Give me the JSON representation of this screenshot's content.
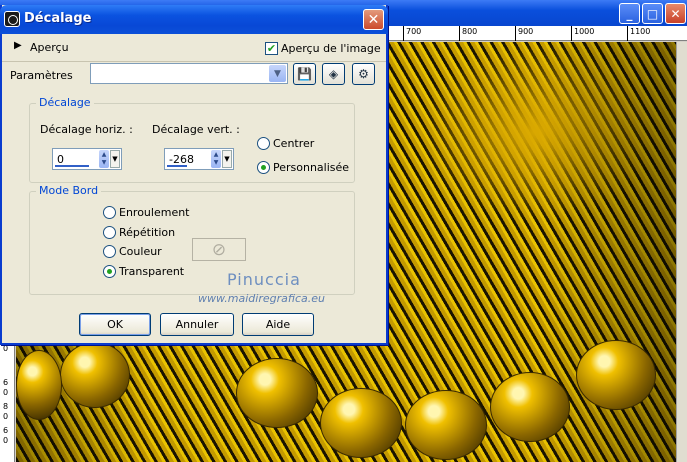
{
  "background_window": {
    "ruler_top_labels": [
      "700",
      "800",
      "900",
      "1000",
      "1100"
    ],
    "ruler_left_labels": [
      "0",
      "6",
      "0",
      "8",
      "0",
      "6",
      "0"
    ]
  },
  "dialog": {
    "title": "Décalage",
    "close_glyph": "✕",
    "preview": {
      "label": "Aperçu",
      "image_preview_label": "Aperçu de l'image",
      "image_preview_checked": true
    },
    "parameters": {
      "label": "Paramètres",
      "preset_value": ""
    },
    "offset_group": {
      "title": "Décalage",
      "horizontal_label": "Décalage horiz. :",
      "horizontal_value": "0",
      "vertical_label": "Décalage vert. :",
      "vertical_value": "-268",
      "center_label": "Centrer",
      "custom_label": "Personnalisée",
      "selected": "custom"
    },
    "edge_group": {
      "title": "Mode Bord",
      "options": [
        "Enroulement",
        "Répétition",
        "Couleur",
        "Transparent"
      ],
      "selected": "Transparent"
    },
    "watermark": {
      "name": "Pinuccia",
      "url": "www.maidiregrafica.eu"
    },
    "buttons": {
      "ok": "OK",
      "cancel": "Annuler",
      "help": "Aide"
    }
  },
  "colors": {
    "titlebar_blue": "#0b53e0",
    "dialog_bg": "#ece9d8",
    "group_title": "#0046d5",
    "check_green": "#21a121",
    "canvas_gold": "#e8c200"
  }
}
